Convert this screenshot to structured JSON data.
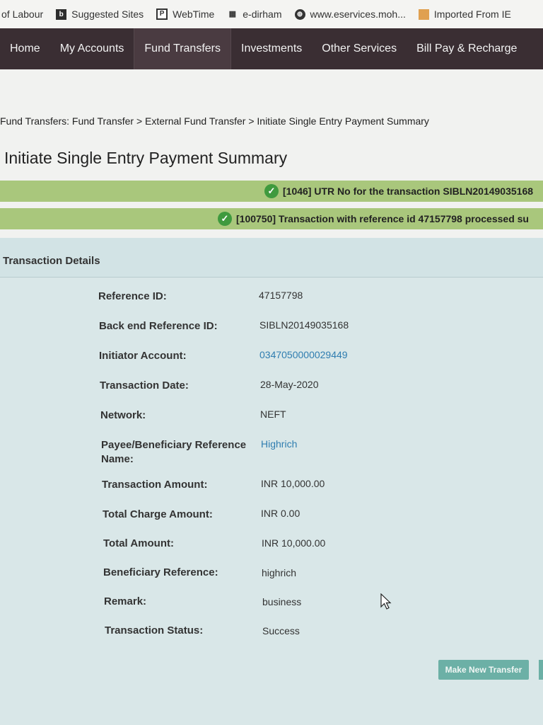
{
  "favorites": [
    {
      "label": "of Labour",
      "icon": "none"
    },
    {
      "label": "Suggested Sites",
      "icon": "bing-icon"
    },
    {
      "label": "WebTime",
      "icon": "webtime-icon"
    },
    {
      "label": "e-dirham",
      "icon": "edirham-icon"
    },
    {
      "label": "www.eservices.moh...",
      "icon": "globe-icon"
    },
    {
      "label": "Imported From IE",
      "icon": "folder-icon"
    }
  ],
  "nav": {
    "items": [
      "Home",
      "My Accounts",
      "Fund Transfers",
      "Investments",
      "Other Services",
      "Bill Pay & Recharge"
    ],
    "active": "Fund Transfers"
  },
  "breadcrumb": "Fund Transfers: Fund Transfer > External Fund Transfer > Initiate Single Entry Payment Summary",
  "page_title": "Initiate Single Entry Payment Summary",
  "messages": [
    "[1046] UTR No for the transaction SIBLN20149035168",
    "[100750] Transaction with reference id 47157798 processed su"
  ],
  "details": {
    "title": "Transaction Details",
    "rows": [
      {
        "label": "Reference ID:",
        "value": "47157798"
      },
      {
        "label": "Back end Reference ID:",
        "value": "SIBLN20149035168"
      },
      {
        "label": "Initiator Account:",
        "value": "0347050000029449"
      },
      {
        "label": "Transaction Date:",
        "value": "28-May-2020"
      },
      {
        "label": "Network:",
        "value": "NEFT"
      },
      {
        "label": "Payee/Beneficiary Reference Name:",
        "value": "Highrich"
      },
      {
        "label": "Transaction Amount:",
        "value": "INR 10,000.00"
      },
      {
        "label": "Total Charge Amount:",
        "value": "INR 0.00"
      },
      {
        "label": "Total Amount:",
        "value": "INR 10,000.00"
      },
      {
        "label": "Beneficiary Reference:",
        "value": "highrich"
      },
      {
        "label": "Remark:",
        "value": "business"
      },
      {
        "label": "Transaction Status:",
        "value": "Success"
      }
    ]
  },
  "actions": {
    "make_new_transfer": "Make New Transfer"
  },
  "colors": {
    "nav_bg": "#3a2e33",
    "message_bg": "#a9c77c",
    "check": "#3f9a3e",
    "panel_bg": "#d9e7e8",
    "link": "#2f7db0",
    "button_bg": "#6cb0a6"
  }
}
